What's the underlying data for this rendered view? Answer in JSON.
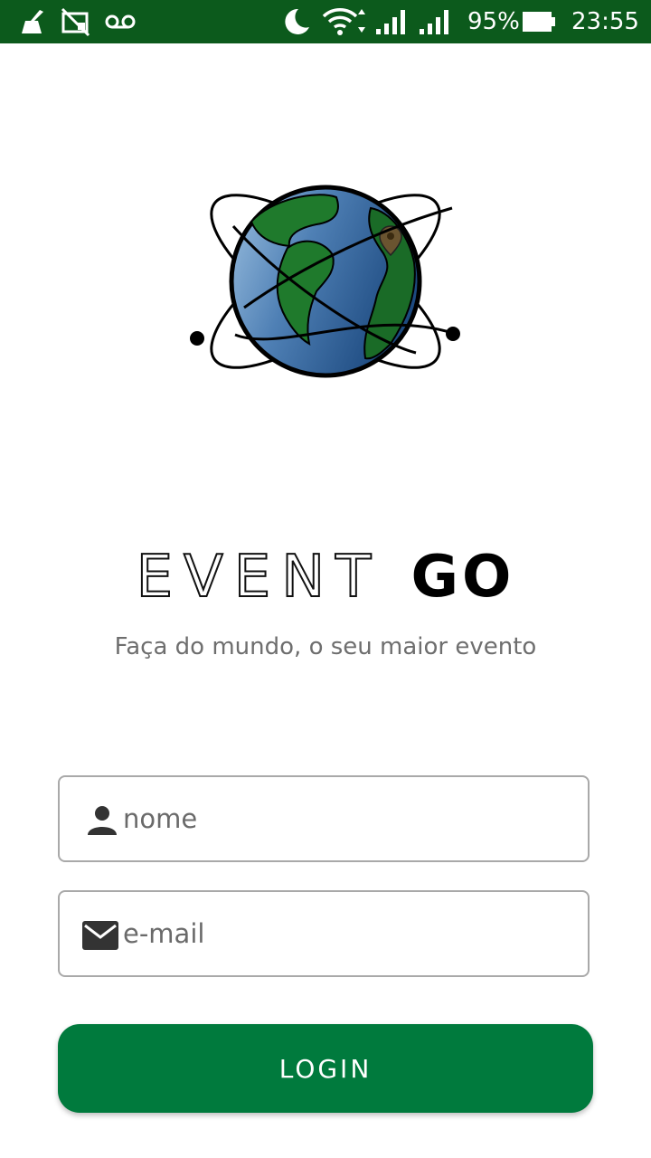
{
  "status_bar": {
    "battery": "95%",
    "time": "23:55",
    "background": "#0c5a1c",
    "icons": [
      "cleaner-icon",
      "screen-cast-off-icon",
      "voicemail-icon",
      "moon-icon",
      "wifi-icon",
      "signal-icon",
      "signal-icon",
      "battery-icon"
    ]
  },
  "brand": {
    "word_outline": "EVENT",
    "word_solid": "GO",
    "tagline": "Faça do mundo, o seu maior evento"
  },
  "form": {
    "name_placeholder": "nome",
    "email_placeholder": "e-mail",
    "login_label": "LOGIN"
  },
  "colors": {
    "accent": "#007a3d",
    "status_bar": "#0c5a1c",
    "input_border": "#a9a9a9",
    "tagline": "#6e6e6e"
  }
}
